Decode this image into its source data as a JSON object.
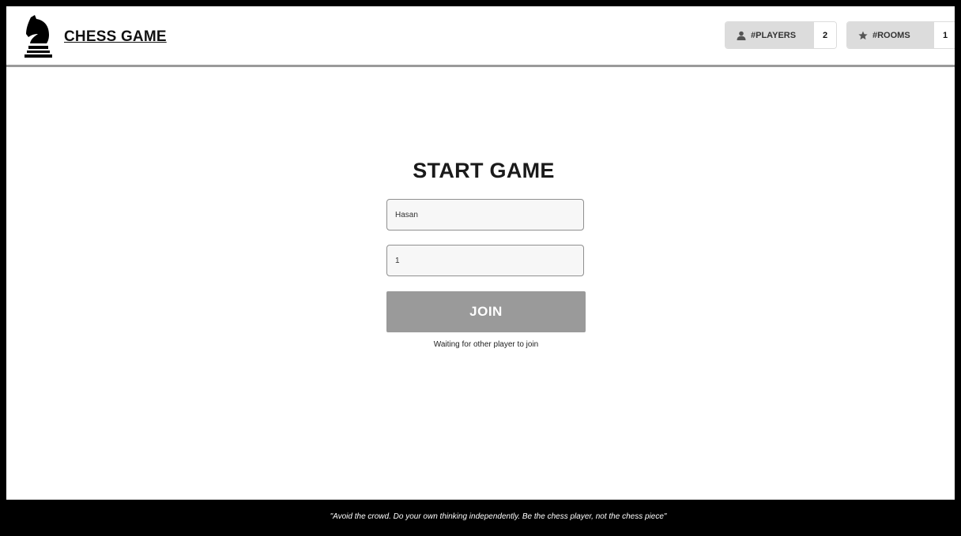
{
  "header": {
    "title": "CHESS GAME",
    "logo_icon": "chess-knight-icon",
    "players": {
      "label": "#PLAYERS",
      "value": "2",
      "icon": "user-icon"
    },
    "rooms": {
      "label": "#ROOMS",
      "value": "1",
      "icon": "star-icon"
    }
  },
  "main": {
    "title": "START GAME",
    "name_field": {
      "value": "Hasan",
      "placeholder": ""
    },
    "room_field": {
      "value": "1",
      "placeholder": ""
    },
    "join_label": "JOIN",
    "status": "Waiting for other player to join"
  },
  "footer": {
    "quote": "\"Avoid the crowd. Do your own thinking independently. Be the chess player, not the chess piece\""
  },
  "colors": {
    "button": "#9a9a9a",
    "badge": "#dcdcdc",
    "footer": "#000000"
  }
}
